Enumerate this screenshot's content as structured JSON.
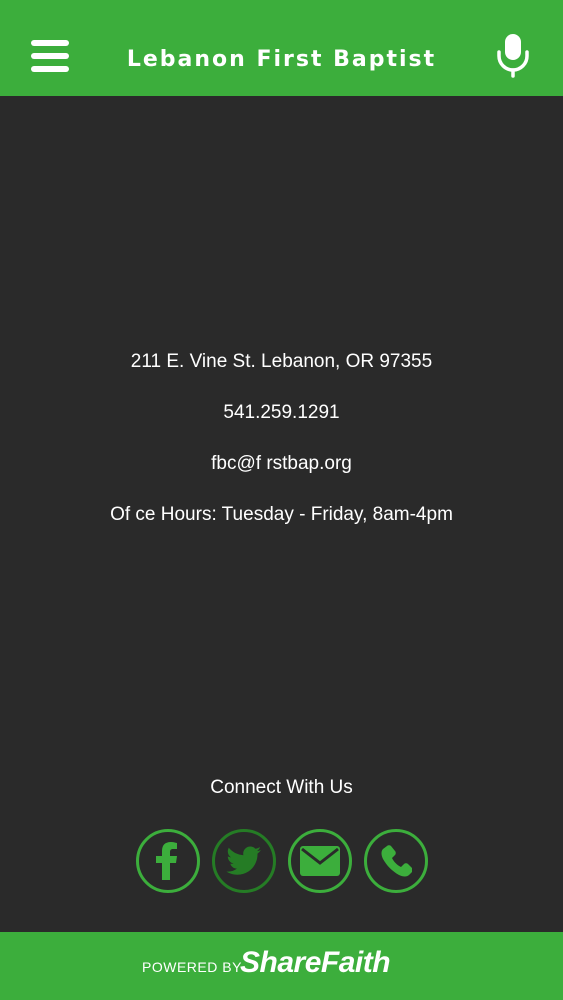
{
  "header": {
    "title": "Lebanon First Baptist",
    "menu_icon": "hamburger-menu-icon",
    "mic_icon": "microphone-icon"
  },
  "contact": {
    "address": "211 E. Vine St. Lebanon, OR 97355",
    "phone": "541.259.1291",
    "email": "fbc@f rstbap.org",
    "hours": "Of  ce Hours: Tuesday - Friday, 8am-4pm"
  },
  "connect": {
    "title": "Connect With Us",
    "icons": [
      "facebook-icon",
      "twitter-icon",
      "email-icon",
      "phone-icon"
    ]
  },
  "footer": {
    "powered_by": "POWERED BY",
    "brand": "ShareFaith"
  },
  "colors": {
    "accent": "#3cae3c",
    "background": "#2a2a2a",
    "text": "#ffffff"
  }
}
